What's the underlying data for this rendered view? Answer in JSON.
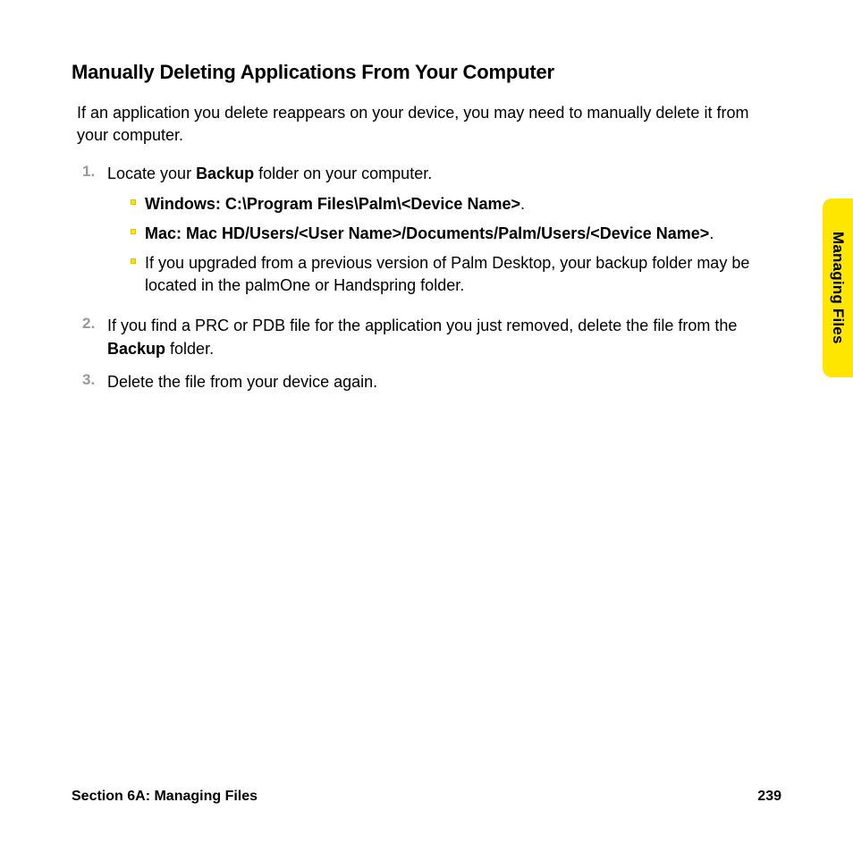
{
  "heading": "Manually Deleting Applications From Your Computer",
  "intro": "If an application you delete reappears on your device, you may need to manually delete it from your computer.",
  "steps": [
    {
      "num": "1.",
      "text_pre": "Locate your ",
      "text_bold": "Backup",
      "text_post": " folder on your computer.",
      "sub": [
        {
          "bold": "Windows: C:\\Program Files\\Palm\\<Device Name>",
          "tail": "."
        },
        {
          "bold": "Mac: Mac HD/Users/<User Name>/Documents/Palm/Users/<Device Name>",
          "tail": "."
        },
        {
          "plain": "If you upgraded from a previous version of Palm Desktop, your backup folder may be located in the palmOne or Handspring folder."
        }
      ]
    },
    {
      "num": "2.",
      "text_pre": "If you find a PRC or PDB file for the application you just removed, delete the file from the ",
      "text_bold": "Backup",
      "text_post": " folder."
    },
    {
      "num": "3.",
      "text_pre": "Delete the file from your device again.",
      "text_bold": "",
      "text_post": ""
    }
  ],
  "side_tab": "Managing Files",
  "footer_left": "Section 6A: Managing Files",
  "footer_right": "239"
}
